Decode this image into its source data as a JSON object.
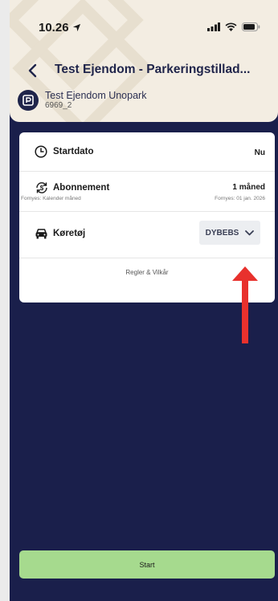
{
  "status_bar": {
    "time": "10.26"
  },
  "header": {
    "title": "Test Ejendom - Parkeringstillad...",
    "provider_name": "Test Ejendom Unopark",
    "provider_id": "6969_2"
  },
  "form": {
    "startdato": {
      "label": "Startdato",
      "value": "Nu"
    },
    "abonnement": {
      "label": "Abonnement",
      "renew_note": "Fornyes: Kalender måned",
      "value": "1 måned",
      "renew_date": "Fornyes: 01 jan. 2026"
    },
    "koretoj": {
      "label": "Køretøj",
      "selected": "DYBEBS"
    },
    "rules_link": "Regler & Vilkår"
  },
  "start_button": "Start",
  "colors": {
    "header_bg": "#f3ede2",
    "page_bg": "#1a1f4b",
    "start_button": "#a6da8e",
    "annotation_arrow": "#e8312d"
  }
}
